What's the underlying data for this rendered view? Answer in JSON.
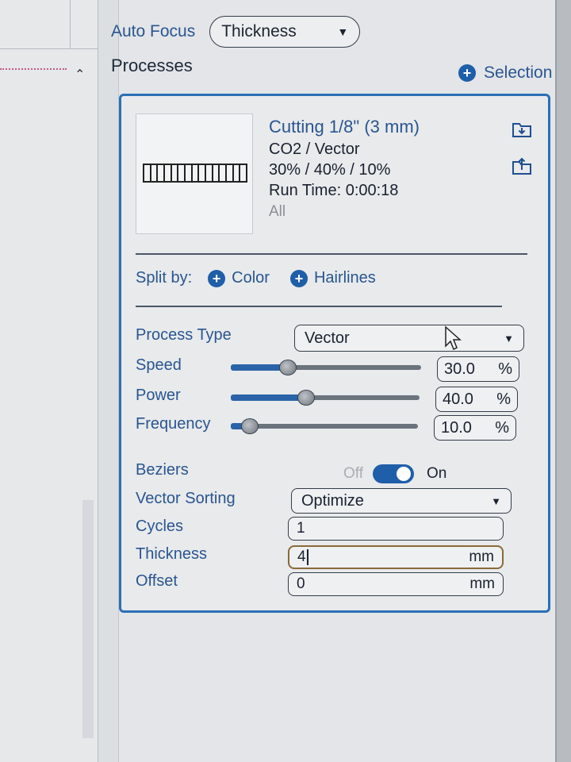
{
  "header": {
    "auto_focus_label": "Auto Focus",
    "auto_focus_value": "Thickness",
    "processes_title": "Processes",
    "selection_label": "Selection"
  },
  "process": {
    "name": "Cutting 1/8\" (3 mm)",
    "laser_mode": "CO2 / Vector",
    "settings_summary": "30% / 40% / 10%",
    "run_time": "Run Time: 0:00:18",
    "scope": "All"
  },
  "split": {
    "label": "Split by:",
    "color_label": "Color",
    "hairlines_label": "Hairlines"
  },
  "params": {
    "process_type_label": "Process Type",
    "process_type_value": "Vector",
    "speed_label": "Speed",
    "speed_value": "30.0",
    "speed_level": 30,
    "power_label": "Power",
    "power_value": "40.0",
    "power_level": 40,
    "frequency_label": "Frequency",
    "frequency_value": "10.0",
    "frequency_level": 10,
    "percent_unit": "%",
    "beziers_label": "Beziers",
    "beziers_off": "Off",
    "beziers_on": "On",
    "beziers_enabled": true,
    "vector_sorting_label": "Vector Sorting",
    "vector_sorting_value": "Optimize",
    "cycles_label": "Cycles",
    "cycles_value": "1",
    "thickness_label": "Thickness",
    "thickness_value": "4",
    "thickness_unit": "mm",
    "offset_label": "Offset",
    "offset_value": "0",
    "offset_unit": "mm"
  },
  "colors": {
    "accent": "#2c6fb5",
    "label_blue": "#2a5590",
    "toggle_on": "#1f5ea8"
  },
  "icons": {
    "dropdown": "triangle-down",
    "add": "plus-circle",
    "import": "folder-import-icon",
    "export": "folder-export-icon"
  }
}
